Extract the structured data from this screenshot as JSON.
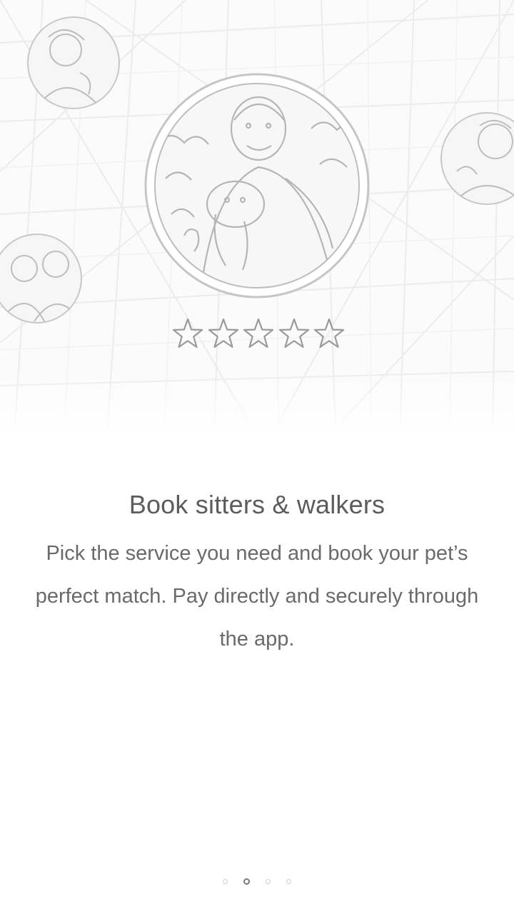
{
  "onboarding": {
    "title": "Book sitters & walkers",
    "body": "Pick the service you need and book your pet’s perfect match. Pay directly and securely through the app."
  },
  "rating": {
    "stars_total": 5,
    "stars_filled": 0
  },
  "pager": {
    "total_pages": 4,
    "active_index": 1
  },
  "colors": {
    "background": "#ffffff",
    "title_text": "#5c5c5c",
    "body_text": "#6a6a6a",
    "star_outline": "#9a9a9a",
    "dot_inactive": "#cfcfcf",
    "dot_active": "#7a7a7a"
  },
  "icons": {
    "star": "star-outline-icon",
    "avatar": "user-avatar"
  }
}
